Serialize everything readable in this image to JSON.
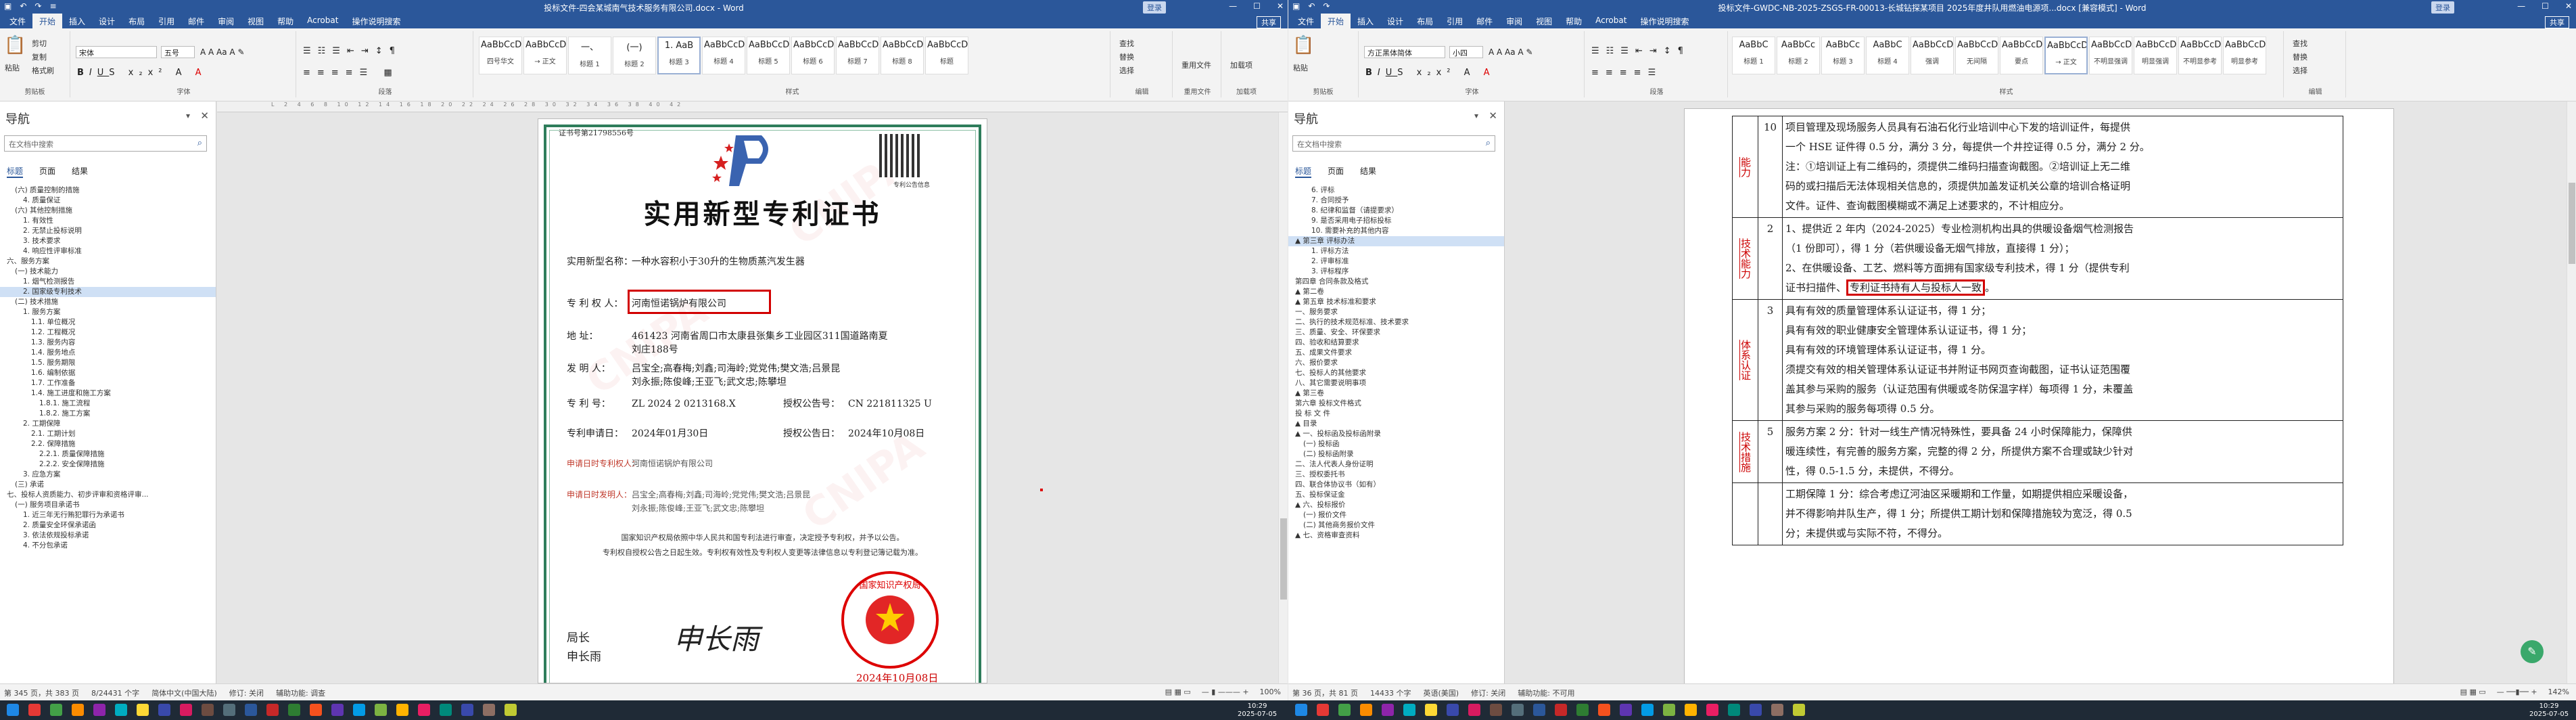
{
  "window_left": {
    "title": "投标文件-四会某城南气技术服务有限公司.docx - Word",
    "quick_access": [
      "↶",
      "↷",
      "≡"
    ],
    "tabs": [
      "文件",
      "开始",
      "插入",
      "设计",
      "布局",
      "引用",
      "邮件",
      "审阅",
      "视图",
      "帮助",
      "Acrobat",
      "操作说明搜索"
    ],
    "share": "共享",
    "login": "登录",
    "ribbon": {
      "clipboard": {
        "paste": "粘贴",
        "cut": "剪切",
        "copy": "复制",
        "format_painter": "格式刷",
        "group": "剪贴板"
      },
      "font": {
        "name": "宋体",
        "size": "五号",
        "group": "字体"
      },
      "paragraph": {
        "group": "段落"
      },
      "styles": {
        "items": [
          {
            "preview": "AaBbCcD",
            "name": "四号华文"
          },
          {
            "preview": "AaBbCcD",
            "name": "→ 正文"
          },
          {
            "preview": "一、",
            "name": "标题 1"
          },
          {
            "preview": "(一)",
            "name": "标题 2"
          },
          {
            "preview": "1. AaB",
            "name": "标题 3"
          },
          {
            "preview": "AaBbCcD",
            "name": "标题 4"
          },
          {
            "preview": "AaBbCcD",
            "name": "标题 5"
          },
          {
            "preview": "AaBbCcD",
            "name": "标题 6"
          },
          {
            "preview": "AaBbCcD",
            "name": "标题 7"
          },
          {
            "preview": "AaBbCcD",
            "name": "标题 8"
          },
          {
            "preview": "AaBbCcD",
            "name": "标题"
          }
        ],
        "group": "样式"
      },
      "editing": {
        "find": "查找",
        "replace": "替换",
        "select": "选择",
        "group": "编辑"
      },
      "reuse": {
        "label": "重用文件",
        "group": "重用文件"
      },
      "addin": {
        "label": "加载项",
        "group": "加载项"
      }
    },
    "nav": {
      "title": "导航",
      "search_placeholder": "在文档中搜索",
      "tabs": [
        "标题",
        "页面",
        "结果"
      ],
      "items": [
        "(六) 质量控制的措施",
        "4. 质量保证",
        "(六) 其他控制措施",
        "1. 有效性",
        "2. 无禁止投标说明",
        "3. 技术要求",
        "4. 响应性评审标准",
        "六、服务方案",
        "(一) 技术能力",
        "1. 烟气检测报告",
        "2. 国家级专利技术",
        "(二) 技术措施",
        "1. 服务方案",
        "1.1. 单位概况",
        "1.2. 工程概况",
        "1.3. 服务内容",
        "1.4. 服务地点",
        "1.5. 服务期限",
        "1.6. 编制依据",
        "1.7. 工作准备",
        "1.4. 施工进度和施工方案",
        "1.8.1. 施工流程",
        "1.8.2. 施工方案",
        "2. 工期保障",
        "2.1. 工期计划",
        "2.2. 保障措施",
        "2.2.1. 质量保障措施",
        "2.2.2. 安全保障措施",
        "3. 应急方案",
        "(三) 承诺",
        "七、投标人资质能力、初步评审和资格评审...",
        "(一) 服务项目承诺书",
        "1. 近三年无行贿犯罪行为承诺书",
        "2. 质量安全环保承诺函",
        "3. 依法依规投标承诺",
        "4. 不分包承诺"
      ]
    },
    "ruler": "L 2 4 6 8 10 12 14 16 18 20 22 24 26 28 30 32 34 36 38 40 42",
    "certificate": {
      "cert_no": "证书号第21798556号",
      "title": "实用新型专利证书",
      "qr_caption": "专利公告信息",
      "fields": [
        {
          "label": "实用新型名称：",
          "value": "一种水容积小于30升的生物质蒸汽发生器"
        },
        {
          "label": "专 利 权 人：",
          "value": "河南恒诺锅炉有限公司"
        },
        {
          "label": "地      址：",
          "value": "461423 河南省周口市太康县张集乡工业园区311国道路南夏"
        },
        {
          "label": "",
          "value": "刘庄188号"
        },
        {
          "label": "发  明  人：",
          "value": "吕宝全;高春梅;刘鑫;司海岭;党党伟;樊文浩;吕景昆"
        },
        {
          "label": "",
          "value": "刘永振;陈俊峰;王亚飞;武文忠;陈攀坦"
        },
        {
          "label": "专  利  号：",
          "value": "ZL 2024 2 0213168.X"
        },
        {
          "label": "专利申请日：",
          "value": "2024年01月30日"
        }
      ],
      "right_fields": [
        {
          "label": "授权公告号：",
          "value": "CN 221811325 U"
        },
        {
          "label": "授权公告日：",
          "value": "2024年10月08日"
        }
      ],
      "change_fields": [
        {
          "label": "申请日时专利权人：",
          "value": "河南恒诺锅炉有限公司"
        },
        {
          "label": "申请日时发明人：",
          "value": "吕宝全;高春梅;刘鑫;司海岭;党党伟;樊文浩;吕景昆"
        },
        {
          "label": "",
          "value": "刘永振;陈俊峰;王亚飞;武文忠;陈攀坦"
        }
      ],
      "body": [
        "国家知识产权局依照中华人民共和国专利法进行审查，决定授予专利权，并予以公告。",
        "专利权自授权公告之日起生效。专利权有效性及专利权人变更等法律信息以专利登记簿记载为准。"
      ],
      "sig_title": "局长",
      "sig_name": "申长雨",
      "signature": "申长雨",
      "stamp_text": "国家知识产权局",
      "stamp_date": "2024年10月08日"
    },
    "status": {
      "page": "第 345 页，共 383 页",
      "words": "8/24431 个字",
      "lang": "简体中文(中国大陆)",
      "track": "修订: 关闭",
      "access": "辅助功能: 调查",
      "zoom": "100%"
    }
  },
  "window_right": {
    "title": "投标文件-GWDC-NB-2025-ZSGS-FR-00013-长城钻探某项目 2025年度井队用燃油电源项...docx [兼容模式] - Word",
    "tabs": [
      "文件",
      "开始",
      "插入",
      "设计",
      "布局",
      "引用",
      "邮件",
      "审阅",
      "视图",
      "帮助",
      "Acrobat",
      "操作说明搜索"
    ],
    "share": "共享",
    "login": "登录",
    "ribbon": {
      "font": {
        "name": "方正黑体简体",
        "size": "小四",
        "group": "字体"
      },
      "styles": {
        "items": [
          {
            "preview": "AaBbC",
            "name": "标题 1"
          },
          {
            "preview": "AaBbCc",
            "name": "标题 2"
          },
          {
            "preview": "AaBbCc",
            "name": "标题 3"
          },
          {
            "preview": "AaBbC",
            "name": "标题 4"
          },
          {
            "preview": "AaBbCcD",
            "name": "强调"
          },
          {
            "preview": "AaBbCcD",
            "name": "无间隔"
          },
          {
            "preview": "AaBbCcD",
            "name": "要点"
          },
          {
            "preview": "AaBbCcD",
            "name": "→ 正文"
          },
          {
            "preview": "AaBbCcD",
            "name": "不明显强调"
          },
          {
            "preview": "AaBbCcD",
            "name": "明显强调"
          },
          {
            "preview": "AaBbCcD",
            "name": "不明显参考"
          },
          {
            "preview": "AaBbCcD",
            "name": "明显参考"
          }
        ],
        "group": "样式"
      },
      "editing": {
        "find": "查找",
        "replace": "替换",
        "select": "选择",
        "group": "编辑"
      }
    },
    "nav": {
      "title": "导航",
      "search_placeholder": "在文档中搜索",
      "tabs": [
        "标题",
        "页面",
        "结果"
      ],
      "items": [
        "6. 评标",
        "7. 合同授予",
        "8. 纪律和监督（请提要求）",
        "9. 是否采用电子招标投标",
        "10. 需要补充的其他内容",
        "▲ 第三章 评标办法",
        "1. 评标方法",
        "2. 评审标准",
        "3. 评标程序",
        "第四章 合同条款及格式",
        "▲ 第二卷",
        "▲ 第五章 技术标准和要求",
        "一、服务要求",
        "二、执行的技术规范标准、技术要求",
        "三、质量、安全、环保要求",
        "四、验收和结算要求",
        "五、成果文件要求",
        "六、报价要求",
        "七、投标人的其他要求",
        "八、其它需要说明事项",
        "▲ 第三卷",
        "第六章 投标文件格式",
        "投 标 文 件",
        "▲ 目录",
        "▲ 一、投标函及投标函附录",
        "(一) 投标函",
        "(二) 投标函附录",
        "二、法人代表人身份证明",
        "三、授权委托书",
        "四、联合体协议书（如有）",
        "五、投标保证金",
        "▲ 六、投标报价",
        "(一) 报价文件",
        "(二) 其他商务报价文件",
        "▲ 七、资格审查资料"
      ],
      "selected": 5
    },
    "table": {
      "rows": [
        {
          "cat": "能力",
          "score": "10",
          "lines": [
            "项目管理及现场服务人员具有石油石化行业培训中心下发的培训证件，每提供",
            "一个 HSE 证件得 0.5 分，满分 3 分，每提供一个井控证得 0.5 分，满分 2 分。",
            "注：①培训证上有二维码的，须提供二维码扫描查询截图。②培训证上无二维",
            "码的或扫描后无法体现相关信息的，须提供加盖发证机关公章的培训合格证明",
            "文件。证件、查询截图模糊或不满足上述要求的，不计相应分。"
          ]
        },
        {
          "cat": "技术能力",
          "score": "2",
          "lines": [
            "1、提供近 2 年内（2024-2025）专业检测机构出具的供暖设备烟气检测报告",
            "（1 份即可），得 1 分（若供暖设备无烟气排放，直接得 1 分）；",
            "2、在供暖设备、工艺、燃料等方面拥有国家级专利技术，得 1 分（提供专利",
            "证书扫描件、专利证书持有人与投标人一致。"
          ]
        },
        {
          "cat": "体系认证",
          "score": "3",
          "lines": [
            "具有有效的质量管理体系认证证书，得 1 分；",
            "具有有效的职业健康安全管理体系认证证书，得 1 分；",
            "具有有效的环境管理体系认证证书，得 1 分。",
            "须提交有效的相关管理体系认证证书并附证书网页查询截图，证书认证范围覆",
            "盖其参与采购的服务（认证范围有供暖或冬防保温字样）每项得 1 分，未覆盖",
            "其参与采购的服务每项得 0.5 分。"
          ]
        },
        {
          "cat": "技术措施",
          "score": "5",
          "lines": [
            "服务方案 2 分：针对一线生产情况特殊性，要具备 24 小时保障能力，保障供",
            "暖连续性，有完善的服务方案，完整的得 2 分，所提供方案不合理或缺少针对",
            "性，得 0.5-1.5 分，未提供，不得分。"
          ]
        },
        {
          "cat": "",
          "score": "",
          "lines": [
            "工期保障 1 分：综合考虑辽河油区采暖期和工作量，如期提供相应采暖设备，",
            "并不得影响井队生产，得 1 分；所提供工期计划和保障措施较为宽泛，得 0.5",
            "分；未提供或与实际不符，不得分。"
          ]
        }
      ]
    },
    "status": {
      "page": "第 36 页，共 81 页",
      "words": "14433 个字",
      "lang": "英语(美国)",
      "track": "修订: 关闭",
      "access": "辅助功能: 不可用",
      "zoom": "142%"
    }
  },
  "taskbar": {
    "clock_left": {
      "time": "10:29",
      "date": "2025-07-05"
    },
    "clock_right": {
      "time": "10:29",
      "date": "2025-07-05"
    }
  },
  "colors": {
    "word_blue": "#2b579a",
    "cert_green": "#2e7d5b",
    "highlight_red": "#d20000"
  }
}
